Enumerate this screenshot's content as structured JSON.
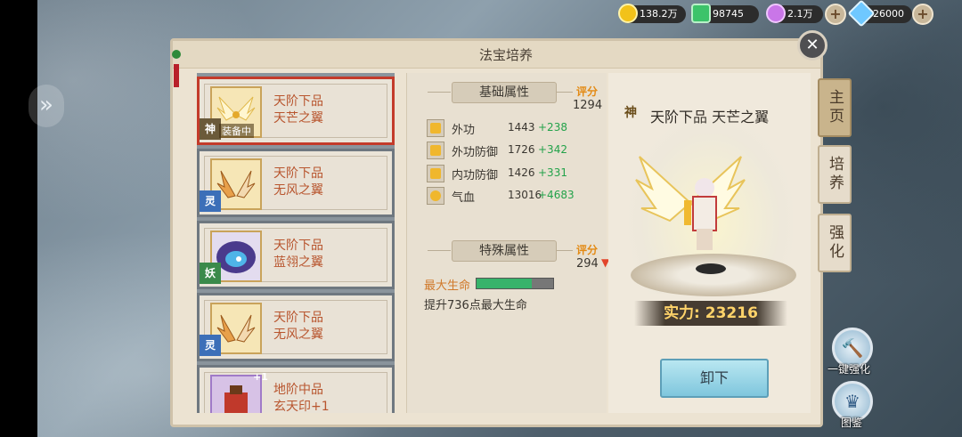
{
  "currency": [
    {
      "icon": "gold-coin-icon",
      "value": "138.2万",
      "color": "#f2c21a"
    },
    {
      "icon": "green-gem-icon",
      "value": "98745",
      "color": "#3cc36a"
    },
    {
      "icon": "purple-orb-icon",
      "value": "2.1万",
      "color": "#c976e8"
    },
    {
      "icon": "diamond-icon",
      "value": "26000",
      "color": "#6fc8ff"
    }
  ],
  "panel": {
    "title": "法宝培养"
  },
  "items": [
    {
      "grade": "天阶下品",
      "name": "天芒之翼",
      "badge": "神",
      "tag": "装备中",
      "selected": true
    },
    {
      "grade": "天阶下品",
      "name": "无风之翼",
      "badge": "灵"
    },
    {
      "grade": "天阶下品",
      "name": "蓝翎之翼",
      "badge": "妖"
    },
    {
      "grade": "天阶下品",
      "name": "无风之翼",
      "badge": "灵"
    },
    {
      "grade": "地阶中品",
      "name": "玄天印+1",
      "badge": "+1"
    }
  ],
  "base": {
    "header": "基础属性",
    "score_label": "评分",
    "score": "1294",
    "stats": [
      {
        "name": "外功",
        "value": "1443",
        "add": "+238"
      },
      {
        "name": "外功防御",
        "value": "1726",
        "add": "+342"
      },
      {
        "name": "内功防御",
        "value": "1426",
        "add": "+331"
      },
      {
        "name": "气血",
        "value": "13016",
        "add": "+4683"
      }
    ]
  },
  "special": {
    "header": "特殊属性",
    "score_label": "评分",
    "score": "294",
    "attr_name": "最大生命",
    "progress": 0.72,
    "desc": "提升736点最大生命"
  },
  "display": {
    "badge": "神",
    "title": "天阶下品 天芒之翼",
    "power_label": "实力:",
    "power_value": "23216",
    "power_text": "实力: 23216",
    "unequip_label": "卸下"
  },
  "tabs": [
    {
      "label": "主页",
      "active": true
    },
    {
      "label": "培养",
      "active": false
    },
    {
      "label": "强化",
      "active": false
    }
  ],
  "side_buttons": {
    "upgrade_label": "一键强化",
    "atlas_label": "图鉴"
  }
}
